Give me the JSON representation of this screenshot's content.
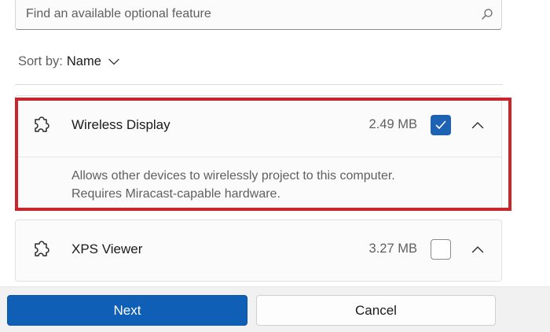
{
  "search": {
    "placeholder": "Find an available optional feature"
  },
  "sort": {
    "label": "Sort by:",
    "value": "Name"
  },
  "features": [
    {
      "name": "Wireless Display",
      "size": "2.49 MB",
      "checked": true,
      "expanded": true,
      "description_line1": "Allows other devices to wirelessly project to this computer.",
      "description_line2": "Requires Miracast-capable hardware."
    },
    {
      "name": "XPS Viewer",
      "size": "3.27 MB",
      "checked": false,
      "expanded": false
    }
  ],
  "buttons": {
    "next": "Next",
    "cancel": "Cancel"
  },
  "colors": {
    "accent": "#0e5fb5",
    "highlight": "#c9252d"
  }
}
